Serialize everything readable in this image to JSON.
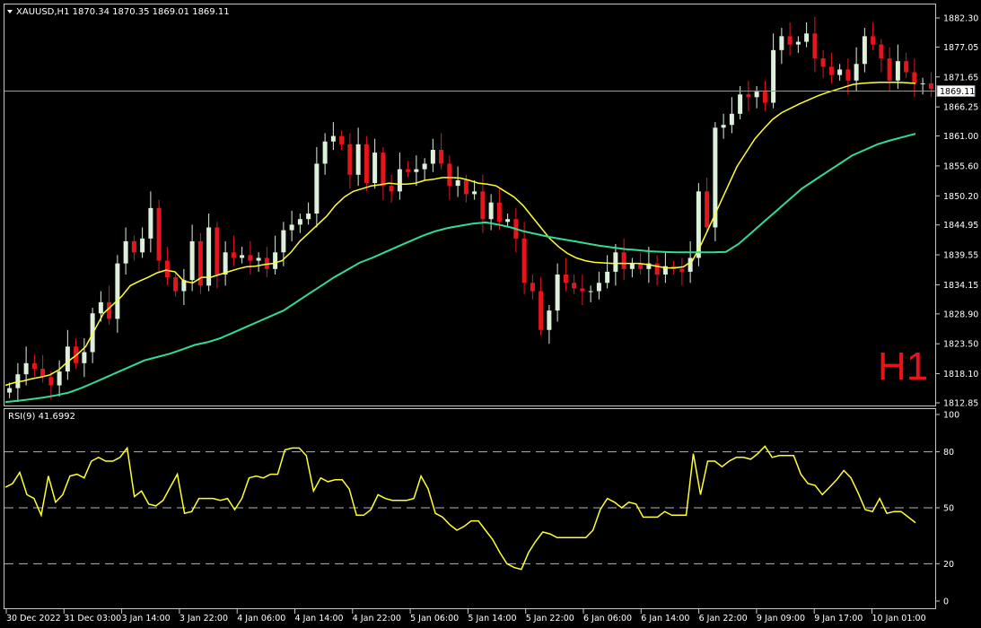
{
  "symbol_header": "XAUUSD,H1  1870.34 1870.35 1869.01 1869.11",
  "timeframe_badge": "H1",
  "current_price_label": "1869.11",
  "colors": {
    "background": "#000000",
    "frame": "#c8c8c8",
    "bull_candle": "#dcf0dc",
    "bear_candle": "#e8141c",
    "ma_fast": "#ffff32",
    "ma_slow": "#32dc96",
    "rsi_line": "#ffff32",
    "timeframe_badge": "#e8141c"
  },
  "chart_data": [
    {
      "type": "candlestick",
      "title": "XAUUSD,H1  1870.34 1870.35 1869.01 1869.11",
      "ylim": [
        1812.85,
        1882.3
      ],
      "y_ticks": [
        "1882.30",
        "1877.05",
        "1871.65",
        "1866.25",
        "1861.00",
        "1855.60",
        "1850.20",
        "1844.95",
        "1839.55",
        "1834.15",
        "1828.90",
        "1823.50",
        "1818.10",
        "1812.85"
      ],
      "x_tick_labels": [
        "30 Dec 2022",
        "31 Dec 03:00",
        "3 Jan 14:00",
        "3 Jan 22:00",
        "4 Jan 06:00",
        "4 Jan 14:00",
        "4 Jan 22:00",
        "5 Jan 06:00",
        "5 Jan 14:00",
        "5 Jan 22:00",
        "6 Jan 06:00",
        "6 Jan 14:00",
        "6 Jan 22:00",
        "9 Jan 09:00",
        "9 Jan 17:00",
        "10 Jan 01:00"
      ],
      "current_price": 1869.11,
      "closes": [
        1815.5,
        1818.0,
        1820.0,
        1819.0,
        1817.5,
        1816.0,
        1818.5,
        1823.0,
        1820.0,
        1822.0,
        1829.0,
        1831.0,
        1828.0,
        1838.0,
        1842.0,
        1840.0,
        1842.5,
        1848.0,
        1838.5,
        1835.5,
        1833.0,
        1835.0,
        1842.0,
        1834.0,
        1844.5,
        1836.0,
        1840.0,
        1839.0,
        1839.5,
        1838.5,
        1839.0,
        1837.0,
        1840.0,
        1844.0,
        1845.0,
        1846.0,
        1847.0,
        1856.0,
        1860.0,
        1861.0,
        1859.5,
        1854.0,
        1859.5,
        1852.5,
        1858.0,
        1852.0,
        1851.0,
        1855.0,
        1854.5,
        1855.0,
        1856.0,
        1858.5,
        1856.0,
        1852.0,
        1853.0,
        1850.5,
        1851.0,
        1846.0,
        1849.0,
        1845.5,
        1846.0,
        1842.5,
        1834.5,
        1833.0,
        1826.0,
        1829.5,
        1836.0,
        1834.5,
        1833.5,
        1833.0,
        1833.0,
        1834.5,
        1836.5,
        1840.0,
        1837.0,
        1838.0,
        1837.0,
        1838.0,
        1836.0,
        1837.5,
        1837.0,
        1836.5,
        1839.0,
        1851.0,
        1844.5,
        1862.5,
        1863.0,
        1865.0,
        1868.5,
        1868.0,
        1869.0,
        1867.0,
        1876.5,
        1879.0,
        1877.5,
        1878.0,
        1879.5,
        1875.0,
        1873.5,
        1872.0,
        1873.0,
        1871.0,
        1874.0,
        1879.0,
        1877.5,
        1875.0,
        1871.0,
        1874.5,
        1872.5,
        1870.5,
        1870.5,
        1869.5
      ],
      "ma_fast": [
        1816.0,
        1816.5,
        1816.8,
        1817.2,
        1817.5,
        1817.9,
        1818.8,
        1820.3,
        1821.5,
        1823.0,
        1826.0,
        1829.0,
        1830.5,
        1832.0,
        1834.0,
        1834.8,
        1835.5,
        1836.3,
        1836.8,
        1836.5,
        1834.8,
        1834.5,
        1835.5,
        1835.5,
        1836.0,
        1836.5,
        1837.0,
        1837.4,
        1837.5,
        1837.8,
        1838.0,
        1838.5,
        1840.0,
        1842.0,
        1843.5,
        1845.0,
        1846.5,
        1848.5,
        1850.0,
        1851.0,
        1851.5,
        1852.0,
        1852.2,
        1852.5,
        1852.3,
        1852.3,
        1852.5,
        1853.0,
        1853.2,
        1853.5,
        1853.5,
        1853.4,
        1853.0,
        1852.5,
        1852.3,
        1852.0,
        1851.0,
        1850.0,
        1848.5,
        1846.5,
        1844.5,
        1842.5,
        1841.0,
        1839.8,
        1839.0,
        1838.5,
        1838.2,
        1838.1,
        1838.0,
        1838.0,
        1838.0,
        1838.0,
        1837.8,
        1837.5,
        1837.2,
        1837.2,
        1837.4,
        1838.5,
        1841.5,
        1845.0,
        1848.5,
        1852.0,
        1855.5,
        1858.0,
        1860.5,
        1862.3,
        1864.0,
        1865.2,
        1866.0,
        1866.8,
        1867.5,
        1868.2,
        1868.8,
        1869.3,
        1869.8,
        1870.3,
        1870.5,
        1870.6,
        1870.7,
        1870.7,
        1870.7,
        1870.6,
        1870.5
      ],
      "ma_slow": [
        1813.0,
        1813.2,
        1813.5,
        1813.8,
        1814.2,
        1814.7,
        1815.5,
        1816.5,
        1817.5,
        1818.5,
        1819.5,
        1820.5,
        1821.1,
        1821.7,
        1822.5,
        1823.3,
        1823.8,
        1824.5,
        1825.5,
        1826.5,
        1827.5,
        1828.5,
        1829.5,
        1831.0,
        1832.5,
        1834.0,
        1835.5,
        1836.8,
        1838.1,
        1839.0,
        1840.0,
        1841.0,
        1842.0,
        1843.0,
        1843.8,
        1844.4,
        1844.8,
        1845.2,
        1845.4,
        1845.0,
        1844.5,
        1843.8,
        1843.3,
        1842.8,
        1842.4,
        1842.0,
        1841.6,
        1841.2,
        1840.9,
        1840.6,
        1840.4,
        1840.2,
        1840.1,
        1840.0,
        1840.0,
        1840.0,
        1840.0,
        1840.1,
        1841.5,
        1843.5,
        1845.5,
        1847.5,
        1849.5,
        1851.5,
        1853.0,
        1854.5,
        1856.0,
        1857.5,
        1858.5,
        1859.5,
        1860.2,
        1860.8,
        1861.4
      ]
    },
    {
      "type": "line",
      "title": "RSI(9) 41.6992",
      "ylim": [
        0,
        100
      ],
      "y_ticks": [
        100,
        80,
        50,
        20,
        0
      ],
      "levels": [
        80,
        50,
        20
      ],
      "values": [
        61,
        63,
        69,
        57,
        55,
        46,
        67,
        53,
        57,
        67,
        68,
        66,
        75,
        77,
        75,
        75,
        77,
        82,
        56,
        59,
        52,
        51,
        54,
        61,
        68,
        47,
        48,
        55,
        55,
        55,
        54,
        55,
        49,
        55,
        66,
        67,
        66,
        68,
        68,
        81,
        82,
        82,
        78,
        59,
        66,
        64,
        65,
        65,
        60,
        46,
        46,
        49,
        57,
        55,
        54,
        54,
        54,
        55,
        67,
        60,
        47,
        45,
        41,
        38,
        40,
        43,
        43,
        38,
        33,
        26,
        20,
        18,
        17,
        26,
        32,
        37,
        36,
        34,
        34,
        34,
        34,
        34,
        38,
        49,
        55,
        53,
        50,
        53,
        52,
        45,
        45,
        45,
        48,
        46,
        46,
        46,
        79,
        57,
        75,
        75,
        72,
        75,
        77,
        77,
        76,
        79,
        83,
        77,
        78,
        78,
        78,
        68,
        63,
        62,
        57,
        61,
        65,
        70,
        66,
        58,
        49,
        48,
        55,
        47,
        48,
        48,
        45,
        42
      ]
    }
  ]
}
